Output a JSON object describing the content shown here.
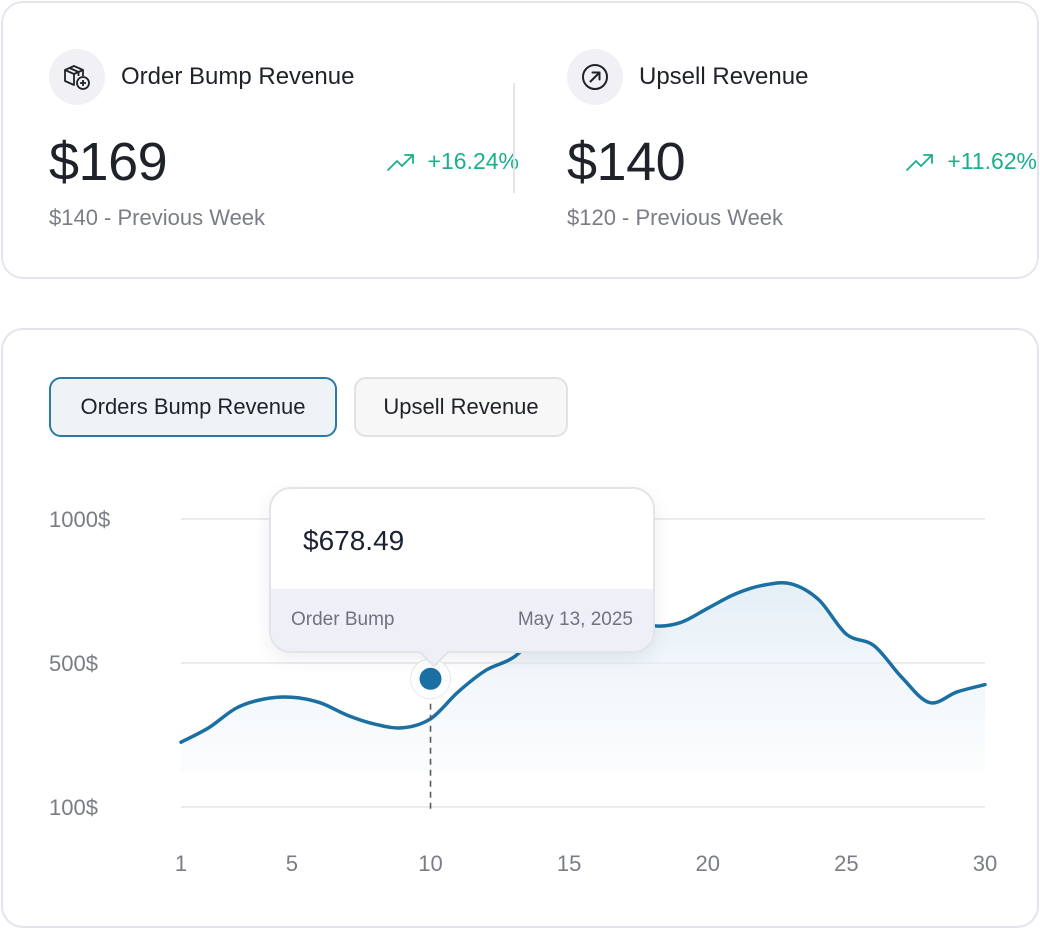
{
  "metrics": [
    {
      "title": "Order Bump Revenue",
      "icon": "box-add-icon",
      "value": "$169",
      "change": "+16.24%",
      "previous": "$140 - Previous Week"
    },
    {
      "title": "Upsell Revenue",
      "icon": "arrow-up-right-circle-icon",
      "value": "$140",
      "change": "+11.62%",
      "previous": "$120 - Previous Week"
    }
  ],
  "tabs": {
    "active": "Orders Bump Revenue",
    "inactive": "Upsell Revenue"
  },
  "colors": {
    "accent": "#1a6fa3",
    "positive": "#19b08b",
    "grid": "#e6e6ea"
  },
  "tooltip": {
    "value": "$678.49",
    "series": "Order Bump",
    "date": "May 13, 2025"
  },
  "chart_data": {
    "type": "area",
    "y_tick_labels": [
      "1000$",
      "500$",
      "100$"
    ],
    "x_tick_labels": [
      "1",
      "5",
      "10",
      "15",
      "20",
      "25",
      "30"
    ],
    "x": [
      1,
      2,
      3,
      4,
      5,
      6,
      7,
      8,
      9,
      10,
      11,
      12,
      13,
      14,
      15,
      16,
      17,
      18,
      19,
      20,
      21,
      22,
      23,
      24,
      25,
      26,
      27,
      28,
      29,
      30
    ],
    "values": [
      280,
      320,
      375,
      400,
      405,
      390,
      355,
      330,
      320,
      345,
      420,
      480,
      520,
      610,
      690,
      710,
      670,
      630,
      640,
      690,
      740,
      770,
      775,
      720,
      600,
      560,
      460,
      390,
      420,
      440
    ],
    "highlight_x": 10,
    "grid": true
  }
}
